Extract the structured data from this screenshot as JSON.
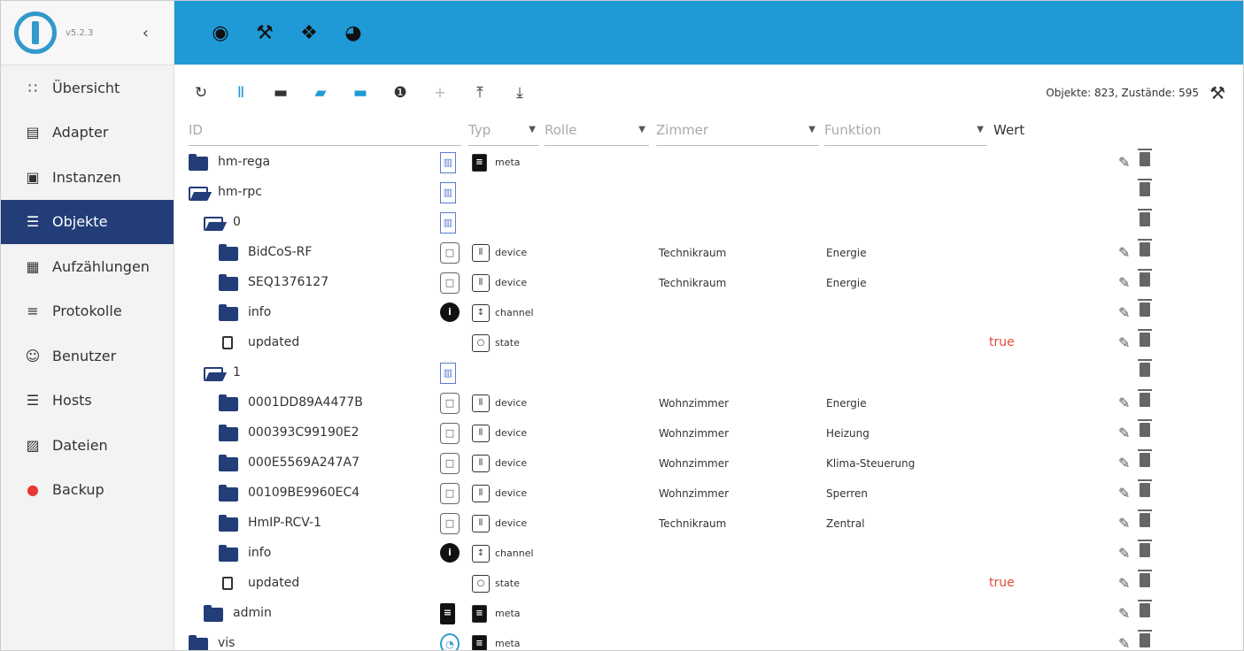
{
  "app": {
    "version": "v5.2.3"
  },
  "sidebar": {
    "items": [
      {
        "label": "Übersicht",
        "icon": "grid-icon"
      },
      {
        "label": "Adapter",
        "icon": "store-icon"
      },
      {
        "label": "Instanzen",
        "icon": "instances-icon"
      },
      {
        "label": "Objekte",
        "icon": "list-icon",
        "active": true
      },
      {
        "label": "Aufzählungen",
        "icon": "enum-icon"
      },
      {
        "label": "Protokolle",
        "icon": "menu-icon"
      },
      {
        "label": "Benutzer",
        "icon": "user-icon"
      },
      {
        "label": "Hosts",
        "icon": "hosts-icon"
      },
      {
        "label": "Dateien",
        "icon": "files-icon"
      },
      {
        "label": "Backup",
        "icon": "backup-icon"
      }
    ]
  },
  "topbar": {
    "icons": [
      "eye-icon",
      "wrench-icon",
      "bug-icon",
      "head-icon"
    ]
  },
  "toolbar": {
    "counts": "Objekte: 823, Zustände: 595"
  },
  "columns": {
    "id": "ID",
    "typ": "Typ",
    "rolle": "Rolle",
    "zimmer": "Zimmer",
    "funktion": "Funktion",
    "wert": "Wert"
  },
  "rows": [
    {
      "name": "hm-rega",
      "level": 0,
      "kind": "folder-closed",
      "obj_icon": "blueprint",
      "type_icon": "doc",
      "type": "meta",
      "room": "",
      "func": "",
      "value": "",
      "edit": true
    },
    {
      "name": "hm-rpc",
      "level": 0,
      "kind": "folder-open",
      "obj_icon": "blueprint",
      "type_icon": "",
      "type": "",
      "room": "",
      "func": "",
      "value": "",
      "edit": false
    },
    {
      "name": "0",
      "level": 1,
      "kind": "folder-open",
      "obj_icon": "blueprint",
      "type_icon": "",
      "type": "",
      "room": "",
      "func": "",
      "value": "",
      "edit": false
    },
    {
      "name": "BidCoS-RF",
      "level": 2,
      "kind": "folder-closed",
      "obj_icon": "device",
      "type_icon": "sliders",
      "type": "device",
      "room": "Technikraum",
      "func": "Energie",
      "value": "",
      "edit": true
    },
    {
      "name": "SEQ1376127",
      "level": 2,
      "kind": "folder-closed",
      "obj_icon": "device",
      "type_icon": "sliders",
      "type": "device",
      "room": "Technikraum",
      "func": "Energie",
      "value": "",
      "edit": true
    },
    {
      "name": "info",
      "level": 2,
      "kind": "folder-closed",
      "obj_icon": "info",
      "type_icon": "channel",
      "type": "channel",
      "room": "",
      "func": "",
      "value": "",
      "edit": true
    },
    {
      "name": "updated",
      "level": 2,
      "kind": "file",
      "obj_icon": "",
      "type_icon": "state",
      "type": "state",
      "room": "",
      "func": "",
      "value": "true",
      "edit": true
    },
    {
      "name": "1",
      "level": 1,
      "kind": "folder-open",
      "obj_icon": "blueprint",
      "type_icon": "",
      "type": "",
      "room": "",
      "func": "",
      "value": "",
      "edit": false
    },
    {
      "name": "0001DD89A4477B",
      "level": 2,
      "kind": "folder-closed",
      "obj_icon": "device",
      "type_icon": "sliders",
      "type": "device",
      "room": "Wohnzimmer",
      "func": "Energie",
      "value": "",
      "edit": true
    },
    {
      "name": "000393C99190E2",
      "level": 2,
      "kind": "folder-closed",
      "obj_icon": "device",
      "type_icon": "sliders",
      "type": "device",
      "room": "Wohnzimmer",
      "func": "Heizung",
      "value": "",
      "edit": true
    },
    {
      "name": "000E5569A247A7",
      "level": 2,
      "kind": "folder-closed",
      "obj_icon": "device",
      "type_icon": "sliders",
      "type": "device",
      "room": "Wohnzimmer",
      "func": "Klima-Steuerung",
      "value": "",
      "edit": true
    },
    {
      "name": "00109BE9960EC4",
      "level": 2,
      "kind": "folder-closed",
      "obj_icon": "device",
      "type_icon": "sliders",
      "type": "device",
      "room": "Wohnzimmer",
      "func": "Sperren",
      "value": "",
      "edit": true
    },
    {
      "name": "HmIP-RCV-1",
      "level": 2,
      "kind": "folder-closed",
      "obj_icon": "device",
      "type_icon": "sliders",
      "type": "device",
      "room": "Technikraum",
      "func": "Zentral",
      "value": "",
      "edit": true
    },
    {
      "name": "info",
      "level": 2,
      "kind": "folder-closed",
      "obj_icon": "info",
      "type_icon": "channel",
      "type": "channel",
      "room": "",
      "func": "",
      "value": "",
      "edit": true
    },
    {
      "name": "updated",
      "level": 2,
      "kind": "file",
      "obj_icon": "",
      "type_icon": "state",
      "type": "state",
      "room": "",
      "func": "",
      "value": "true",
      "edit": true
    },
    {
      "name": "admin",
      "level": 1,
      "kind": "folder-closed",
      "obj_icon": "doc",
      "type_icon": "doc",
      "type": "meta",
      "room": "",
      "func": "",
      "value": "",
      "edit": true
    },
    {
      "name": "vis",
      "level": 0,
      "kind": "folder-closed",
      "obj_icon": "gauge",
      "type_icon": "doc",
      "type": "meta",
      "room": "",
      "func": "",
      "value": "",
      "edit": true
    }
  ]
}
